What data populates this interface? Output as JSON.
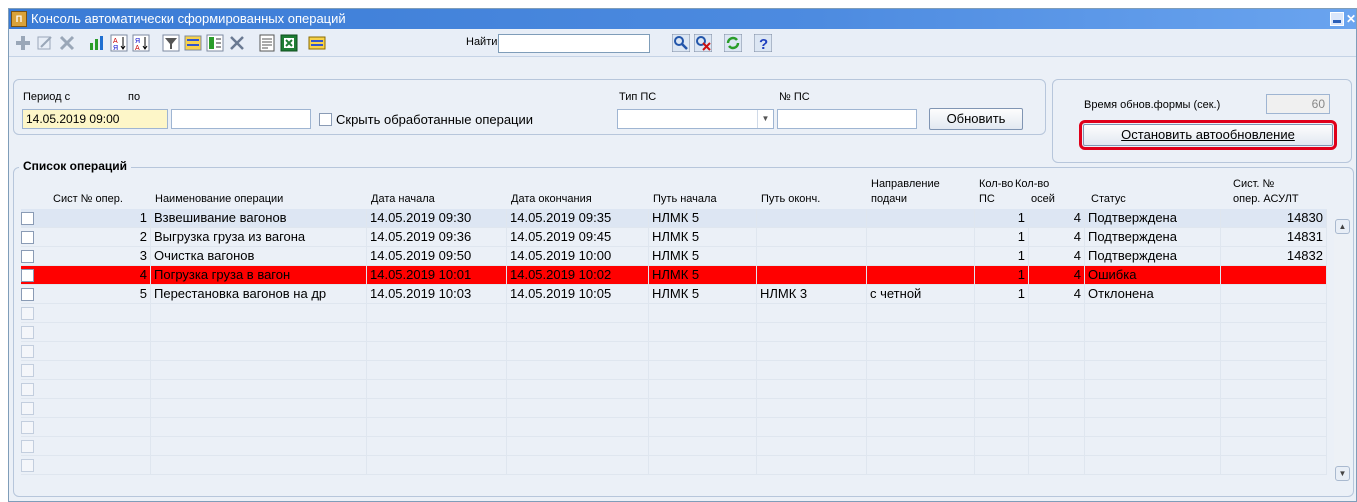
{
  "window": {
    "title": "Консоль автоматически сформированных операций",
    "app_icon_text": "П"
  },
  "toolbar": {
    "find_label": "Найти:",
    "find_value": ""
  },
  "filters": {
    "period_from_label": "Период с",
    "period_from_value": "14.05.2019 09:00",
    "period_to_label": "по",
    "period_to_value": "",
    "hide_processed_label": "Скрыть обработанные операции",
    "ps_type_label": "Тип ПС",
    "ps_type_value": "",
    "ps_number_label": "№ ПС",
    "ps_number_value": "",
    "refresh_button": "Обновить"
  },
  "autorefresh": {
    "interval_label": "Время обнов.формы (сек.)",
    "interval_value": "60",
    "stop_button": "Остановить автообновление"
  },
  "list": {
    "title": "Список операций",
    "columns": {
      "sys_no": "Сист № опер.",
      "name": "Наименование операции",
      "start_date": "Дата начала",
      "end_date": "Дата окончания",
      "start_track": "Путь начала",
      "end_track": "Путь оконч.",
      "direction_1": "Направление",
      "direction_2": "подачи",
      "ps_count_1": "Кол-во",
      "ps_count_2": "ПС",
      "axles_1": "Кол-во",
      "axles_2": "осей",
      "status": "Статус",
      "asult_1": "Сист. №",
      "asult_2": "опер. АСУЛТ"
    },
    "rows": [
      {
        "sys_no": "1",
        "name": "Взвешивание вагонов",
        "start_date": "14.05.2019 09:30",
        "end_date": "14.05.2019 09:35",
        "start_track": "НЛМК 5",
        "end_track": "",
        "direction": "",
        "ps_count": "1",
        "axles": "4",
        "status": "Подтверждена",
        "asult": "14830"
      },
      {
        "sys_no": "2",
        "name": "Выгрузка груза из вагона",
        "start_date": "14.05.2019 09:36",
        "end_date": "14.05.2019 09:45",
        "start_track": "НЛМК 5",
        "end_track": "",
        "direction": "",
        "ps_count": "1",
        "axles": "4",
        "status": "Подтверждена",
        "asult": "14831"
      },
      {
        "sys_no": "3",
        "name": "Очистка вагонов",
        "start_date": "14.05.2019 09:50",
        "end_date": "14.05.2019 10:00",
        "start_track": "НЛМК 5",
        "end_track": "",
        "direction": "",
        "ps_count": "1",
        "axles": "4",
        "status": "Подтверждена",
        "asult": "14832"
      },
      {
        "sys_no": "4",
        "name": "Погрузка груза в вагон",
        "start_date": "14.05.2019 10:01",
        "end_date": "14.05.2019 10:02",
        "start_track": "НЛМК 5",
        "end_track": "",
        "direction": "",
        "ps_count": "1",
        "axles": "4",
        "status": "Ошибка",
        "asult": ""
      },
      {
        "sys_no": "5",
        "name": "Перестановка вагонов на др",
        "start_date": "14.05.2019 10:03",
        "end_date": "14.05.2019 10:05",
        "start_track": "НЛМК 5",
        "end_track": "НЛМК 3",
        "direction": "с четной",
        "ps_count": "1",
        "axles": "4",
        "status": "Отклонена",
        "asult": ""
      }
    ],
    "selected_row_color": "#ff0000"
  },
  "icons": [
    "add-icon",
    "edit-icon",
    "delete-icon",
    "chart-icon",
    "sort-asc-icon",
    "sort-desc-icon",
    "filter-icon",
    "filter-edit-icon",
    "columns-icon",
    "clear-filter-icon",
    "report-icon",
    "excel-icon",
    "export-icon",
    "search-icon",
    "search-clear-icon",
    "refresh-icon",
    "help-icon"
  ]
}
